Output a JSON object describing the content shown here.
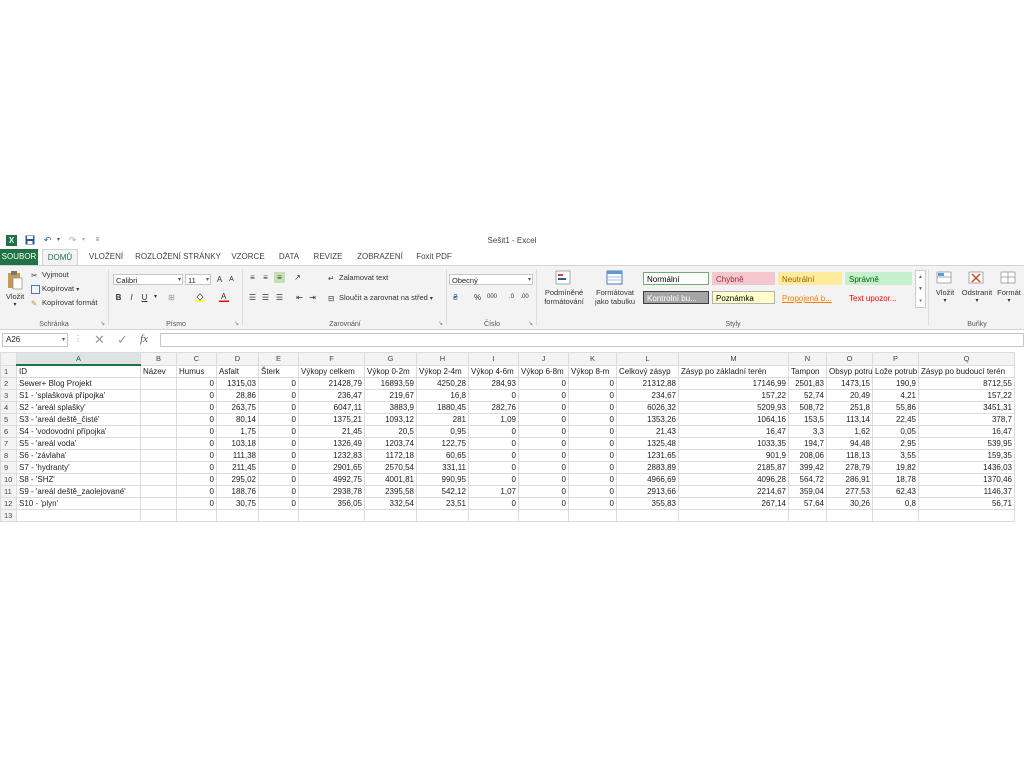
{
  "window_title": "Sešit1 - Excel",
  "tabs": [
    {
      "label": "SOUBOR"
    },
    {
      "label": "DOMŮ"
    },
    {
      "label": "VLOŽENÍ"
    },
    {
      "label": "ROZLOŽENÍ STRÁNKY"
    },
    {
      "label": "VZORCE"
    },
    {
      "label": "DATA"
    },
    {
      "label": "REVIZE"
    },
    {
      "label": "ZOBRAZENÍ"
    },
    {
      "label": "Foxit PDF"
    }
  ],
  "ribbon": {
    "clipboard": {
      "paste": "Vložit",
      "cut": "Vyjmout",
      "copy": "Kopírovat",
      "format_painter": "Kopírovat formát",
      "label": "Schránka"
    },
    "font": {
      "name": "Calibri",
      "size": "11",
      "bold": "B",
      "italic": "I",
      "underline": "U",
      "label": "Písmo"
    },
    "alignment": {
      "wrap": "Zalamovat text",
      "merge": "Sloučit a zarovnat na střed",
      "label": "Zarovnání"
    },
    "number": {
      "format": "Obecný",
      "percent": "%",
      "comma": "000",
      "label": "Číslo"
    },
    "styles": {
      "conditional": "Podmíněné formátování",
      "table": "Formátovat jako tabulku",
      "label": "Styly",
      "cells": [
        {
          "text": "Normální",
          "bg": "#ffffff",
          "color": "#000000",
          "border": "#6fae6f"
        },
        {
          "text": "Chybně",
          "bg": "#f4c7ce",
          "color": "#9c2f39",
          "border": "#f4c7ce"
        },
        {
          "text": "Neutrální",
          "bg": "#ffeb9c",
          "color": "#9c6500",
          "border": "#ffeb9c"
        },
        {
          "text": "Správně",
          "bg": "#c6efce",
          "color": "#006100",
          "border": "#c6efce"
        },
        {
          "text": "Kontrolní bu...",
          "bg": "#a5a5a5",
          "color": "#ffffff",
          "border": "#3f3f3f"
        },
        {
          "text": "Poznámka",
          "bg": "#ffffcc",
          "color": "#000000",
          "border": "#b2b2b2"
        },
        {
          "text": "Propojená b...",
          "bg": "#f3f3f3",
          "color": "#fa7d00",
          "border": "#f3f3f3"
        },
        {
          "text": "Text upozor...",
          "bg": "#f3f3f3",
          "color": "#ff0000",
          "border": "#f3f3f3"
        }
      ]
    },
    "cells": {
      "insert": "Vložit",
      "delete": "Odstranit",
      "format": "Formát",
      "label": "Buňky"
    }
  },
  "formula_bar": {
    "name_box": "A26",
    "fx": "fx",
    "value": ""
  },
  "grid": {
    "columns": [
      "A",
      "B",
      "C",
      "D",
      "E",
      "F",
      "G",
      "H",
      "I",
      "J",
      "K",
      "L",
      "M",
      "N",
      "O",
      "P",
      "Q"
    ],
    "rows": [
      [
        "ID",
        "Název",
        "Humus",
        "Asfalt",
        "Šterk",
        "Výkopy celkem",
        "Výkop 0-2m",
        "Výkop 2-4m",
        "Výkop 4-6m",
        "Výkop 6-8m",
        "Výkop 8-m",
        "Celkový zásyp",
        "Zásyp po základní terén",
        "Tampon",
        "Obsyp potrubí",
        "Lože potrubí",
        "Zásyp po budoucí terén"
      ],
      [
        "Sewer+ Blog Projekt",
        "",
        "0",
        "1315,03",
        "0",
        "21428,79",
        "16893,59",
        "4250,28",
        "284,93",
        "0",
        "0",
        "21312,88",
        "17146,99",
        "2501,83",
        "1473,15",
        "190,9",
        "8712,55"
      ],
      [
        "S1 - 'splašková přípojka'",
        "",
        "0",
        "28,86",
        "0",
        "236,47",
        "219,67",
        "16,8",
        "0",
        "0",
        "0",
        "234,67",
        "157,22",
        "52,74",
        "20,49",
        "4,21",
        "157,22"
      ],
      [
        "S2 - 'areál splašky'",
        "",
        "0",
        "263,75",
        "0",
        "6047,11",
        "3883,9",
        "1880,45",
        "282,76",
        "0",
        "0",
        "6026,32",
        "5209,93",
        "508,72",
        "251,8",
        "55,86",
        "3451,31"
      ],
      [
        "S3 - 'areál deště_čisté'",
        "",
        "0",
        "80,14",
        "0",
        "1375,21",
        "1093,12",
        "281",
        "1,09",
        "0",
        "0",
        "1353,26",
        "1064,16",
        "153,5",
        "113,14",
        "22,45",
        "378,7"
      ],
      [
        "S4 - 'vodovodní přípojka'",
        "",
        "0",
        "1,75",
        "0",
        "21,45",
        "20,5",
        "0,95",
        "0",
        "0",
        "0",
        "21,43",
        "16,47",
        "3,3",
        "1,62",
        "0,05",
        "16,47"
      ],
      [
        "S5 - 'areál voda'",
        "",
        "0",
        "103,18",
        "0",
        "1326,49",
        "1203,74",
        "122,75",
        "0",
        "0",
        "0",
        "1325,48",
        "1033,35",
        "194,7",
        "94,48",
        "2,95",
        "539,95"
      ],
      [
        "S6 - 'závlaha'",
        "",
        "0",
        "111,38",
        "0",
        "1232,83",
        "1172,18",
        "60,65",
        "0",
        "0",
        "0",
        "1231,65",
        "901,9",
        "208,06",
        "118,13",
        "3,55",
        "159,35"
      ],
      [
        "S7 - 'hydranty'",
        "",
        "0",
        "211,45",
        "0",
        "2901,65",
        "2570,54",
        "331,11",
        "0",
        "0",
        "0",
        "2883,89",
        "2185,87",
        "399,42",
        "278,79",
        "19,82",
        "1436,03"
      ],
      [
        "S8 - 'SHZ'",
        "",
        "0",
        "295,02",
        "0",
        "4992,75",
        "4001,81",
        "990,95",
        "0",
        "0",
        "0",
        "4966,69",
        "4096,28",
        "564,72",
        "286,91",
        "18,78",
        "1370,46"
      ],
      [
        "S9 - 'areál deště_zaolejované'",
        "",
        "0",
        "188,76",
        "0",
        "2938,78",
        "2395,58",
        "542,12",
        "1,07",
        "0",
        "0",
        "2913,66",
        "2214,67",
        "359,04",
        "277,53",
        "62,43",
        "1146,37"
      ],
      [
        "S10 - 'plyn'",
        "",
        "0",
        "30,75",
        "0",
        "356,05",
        "332,54",
        "23,51",
        "0",
        "0",
        "0",
        "355,83",
        "267,14",
        "57,64",
        "30,26",
        "0,8",
        "56,71"
      ],
      [
        "",
        "",
        "",
        "",
        "",
        "",
        "",
        "",
        "",
        "",
        "",
        "",
        "",
        "",
        "",
        "",
        ""
      ]
    ]
  }
}
